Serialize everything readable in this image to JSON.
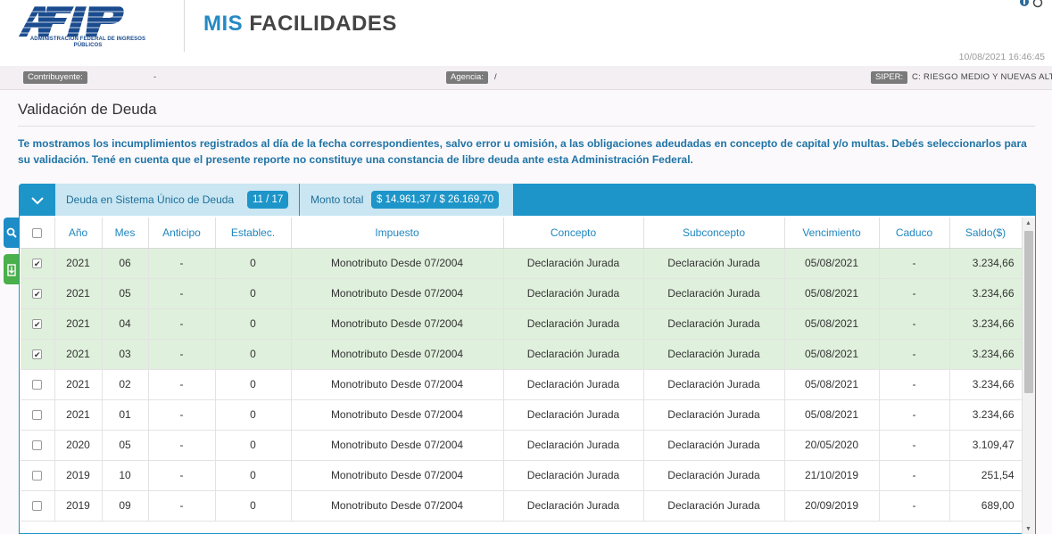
{
  "header": {
    "logo_letters": "AFIP",
    "logo_caption": "ADMINISTRACIÓN FEDERAL DE INGRESOS PÚBLICOS",
    "title_part1": "MIS",
    "title_part2": "FACILIDADES",
    "timestamp": "10/08/2021 16:46:45",
    "icons": [
      "info-icon",
      "power-icon"
    ]
  },
  "infobar": {
    "contribuyente_label": "Contribuyente:",
    "contribuyente_value": "-",
    "agencia_label": "Agencia:",
    "agencia_value": "/",
    "siper_label": "SIPER:",
    "siper_value": "C: RIESGO MEDIO Y NUEVAS ALTAS"
  },
  "page": {
    "title": "Validación de Deuda",
    "intro": "Te mostramos los incumplimientos registrados al día de la fecha correspondientes, salvo error u omisión, a las obligaciones adeudadas en concepto de capital y/o multas. Debés seleccionarlos para su validación. Tené en cuenta que el presente reporte no constituye una constancia de libre deuda ante esta Administración Federal."
  },
  "panel": {
    "tab1_label": "Deuda en Sistema Único de Deuda",
    "tab1_count": "11 / 17",
    "tab2_label": "Monto total",
    "tab2_amount": "$ 14.961,37 / $ 26.169,70"
  },
  "table": {
    "headers": [
      "Año",
      "Mes",
      "Anticipo",
      "Establec.",
      "Impuesto",
      "Concepto",
      "Subconcepto",
      "Vencimiento",
      "Caduco",
      "Saldo($)"
    ],
    "check_mark": "✔",
    "rows": [
      {
        "anio": "2021",
        "mes": "06",
        "anticipo": "-",
        "establec": "0",
        "impuesto": "Monotributo Desde 07/2004",
        "concepto": "Declaración Jurada",
        "subconcepto": "Declaración Jurada",
        "vencimiento": "05/08/2021",
        "caduco": "-",
        "saldo": "3.234,66",
        "checked": true
      },
      {
        "anio": "2021",
        "mes": "05",
        "anticipo": "-",
        "establec": "0",
        "impuesto": "Monotributo Desde 07/2004",
        "concepto": "Declaración Jurada",
        "subconcepto": "Declaración Jurada",
        "vencimiento": "05/08/2021",
        "caduco": "-",
        "saldo": "3.234,66",
        "checked": true
      },
      {
        "anio": "2021",
        "mes": "04",
        "anticipo": "-",
        "establec": "0",
        "impuesto": "Monotributo Desde 07/2004",
        "concepto": "Declaración Jurada",
        "subconcepto": "Declaración Jurada",
        "vencimiento": "05/08/2021",
        "caduco": "-",
        "saldo": "3.234,66",
        "checked": true
      },
      {
        "anio": "2021",
        "mes": "03",
        "anticipo": "-",
        "establec": "0",
        "impuesto": "Monotributo Desde 07/2004",
        "concepto": "Declaración Jurada",
        "subconcepto": "Declaración Jurada",
        "vencimiento": "05/08/2021",
        "caduco": "-",
        "saldo": "3.234,66",
        "checked": true
      },
      {
        "anio": "2021",
        "mes": "02",
        "anticipo": "-",
        "establec": "0",
        "impuesto": "Monotributo Desde 07/2004",
        "concepto": "Declaración Jurada",
        "subconcepto": "Declaración Jurada",
        "vencimiento": "05/08/2021",
        "caduco": "-",
        "saldo": "3.234,66",
        "checked": false
      },
      {
        "anio": "2021",
        "mes": "01",
        "anticipo": "-",
        "establec": "0",
        "impuesto": "Monotributo Desde 07/2004",
        "concepto": "Declaración Jurada",
        "subconcepto": "Declaración Jurada",
        "vencimiento": "05/08/2021",
        "caduco": "-",
        "saldo": "3.234,66",
        "checked": false
      },
      {
        "anio": "2020",
        "mes": "05",
        "anticipo": "-",
        "establec": "0",
        "impuesto": "Monotributo Desde 07/2004",
        "concepto": "Declaración Jurada",
        "subconcepto": "Declaración Jurada",
        "vencimiento": "20/05/2020",
        "caduco": "-",
        "saldo": "3.109,47",
        "checked": false
      },
      {
        "anio": "2019",
        "mes": "10",
        "anticipo": "-",
        "establec": "0",
        "impuesto": "Monotributo Desde 07/2004",
        "concepto": "Declaración Jurada",
        "subconcepto": "Declaración Jurada",
        "vencimiento": "21/10/2019",
        "caduco": "-",
        "saldo": "251,54",
        "checked": false
      },
      {
        "anio": "2019",
        "mes": "09",
        "anticipo": "-",
        "establec": "0",
        "impuesto": "Monotributo Desde 07/2004",
        "concepto": "Declaración Jurada",
        "subconcepto": "Declaración Jurada",
        "vencimiento": "20/09/2019",
        "caduco": "-",
        "saldo": "689,00",
        "checked": false
      }
    ]
  },
  "colors": {
    "brand_blue": "#1d95c9",
    "title_blue": "#2589c4",
    "selected_row": "#dff0dc",
    "export_green": "#4ab04a"
  }
}
